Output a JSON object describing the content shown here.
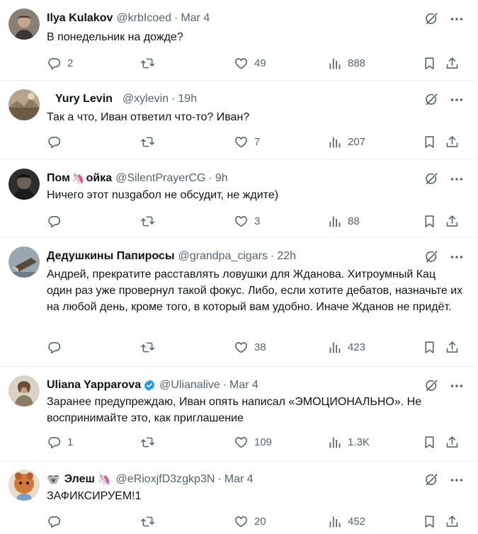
{
  "tweets": [
    {
      "name": "Ilya Kulakov",
      "handle": "@krbIcoed",
      "sep": "·",
      "time": "Mar 4",
      "text": "В понедельник на дожде?",
      "replies": "2",
      "retweets": "",
      "likes": "49",
      "views": "888"
    },
    {
      "name": "Yury Levin",
      "handle": "@xylevin",
      "sep": "·",
      "time": "19h",
      "text": "Так а что, Иван ответил что-то? Иван?",
      "replies": "",
      "retweets": "",
      "likes": "7",
      "views": "207"
    },
    {
      "name_part1": "Пом",
      "name_part2": "ойка",
      "name_emoji": "🦄",
      "handle": "@SilentPrayerCG",
      "sep": "·",
      "time": "9h",
      "text": "Ничего этот nuзgабол не обсудит, не ждите)",
      "replies": "",
      "retweets": "",
      "likes": "3",
      "views": "88"
    },
    {
      "name": "Дедушкины Папиросы",
      "handle": "@grandpa_cigars",
      "sep": "·",
      "time": "22h",
      "text": "Андрей, прекратите расставлять ловушки для Жданова. Хитроумный Кац один раз уже провернул такой фокус. Либо, если хотите дебатов, назначьте их на любой день, кроме того, в который вам удобно. Иначе Жданов не придёт.",
      "replies": "",
      "retweets": "",
      "likes": "38",
      "views": "423"
    },
    {
      "name": "Uliana Yapparova",
      "handle": "@Ulianalive",
      "sep": "·",
      "time": "Mar 4",
      "text": "Заранее предупреждаю, Иван опять написал «ЭМОЦИОНАЛЬНО». Не воспринимайте это, как приглашение",
      "replies": "1",
      "retweets": "",
      "likes": "109",
      "views": "1.3K"
    },
    {
      "name_prefix_emoji": "🐨",
      "name": "Элеш",
      "name_emoji": "🦄",
      "handle": "@eRioxjfD3zgkp3N",
      "sep": "·",
      "time": "Mar 4",
      "text": "ЗАФИКСИРУЕМ!1",
      "replies": "",
      "retweets": "",
      "likes": "20",
      "views": "452"
    }
  ],
  "icons": {
    "reply": "reply-icon",
    "retweet": "retweet-icon",
    "like": "heart-icon",
    "views": "views-icon",
    "bookmark": "bookmark-icon",
    "share": "share-icon",
    "grok": "grok-icon",
    "more": "more-icon",
    "verified": "verified-badge-icon"
  },
  "colors": {
    "text": "#0f1419",
    "secondary": "#536471",
    "border": "#eff3f4",
    "verified": "#1d9bf0"
  }
}
